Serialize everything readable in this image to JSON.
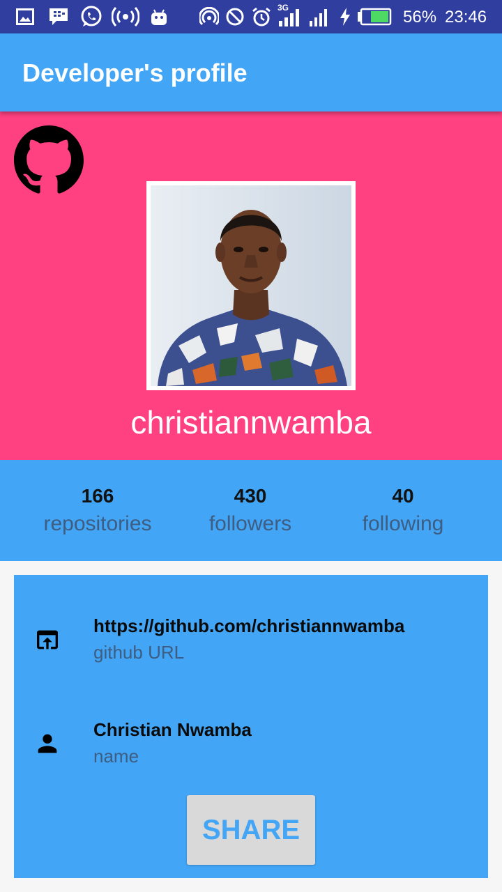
{
  "status_bar": {
    "battery_percent": "56%",
    "time": "23:46",
    "network_type": "3G",
    "background": "#303f9f",
    "left_icons": [
      "gallery-icon",
      "bbm-icon",
      "whatsapp-icon",
      "hotspot-icon",
      "android-icon"
    ],
    "right_icons": [
      "wifi-hotspot-icon",
      "do-not-disturb-icon",
      "alarm-icon",
      "signal-3g-icon",
      "signal-icon",
      "charging-icon",
      "battery-icon"
    ]
  },
  "app_bar": {
    "title": "Developer's profile",
    "color": "#42a5f5"
  },
  "profile": {
    "username": "christiannwamba",
    "header_color": "#ff4081",
    "logo_icon": "github-icon",
    "avatar": "profile-photo"
  },
  "stats": [
    {
      "value": "166",
      "label": "repositories"
    },
    {
      "value": "430",
      "label": "followers"
    },
    {
      "value": "40",
      "label": "following"
    }
  ],
  "details": {
    "url": {
      "value": "https://github.com/christiannwamba",
      "label": "github URL",
      "icon": "open-in-browser-icon"
    },
    "name": {
      "value": "Christian Nwamba",
      "label": "name",
      "icon": "person-icon"
    },
    "share_label": "SHARE"
  }
}
